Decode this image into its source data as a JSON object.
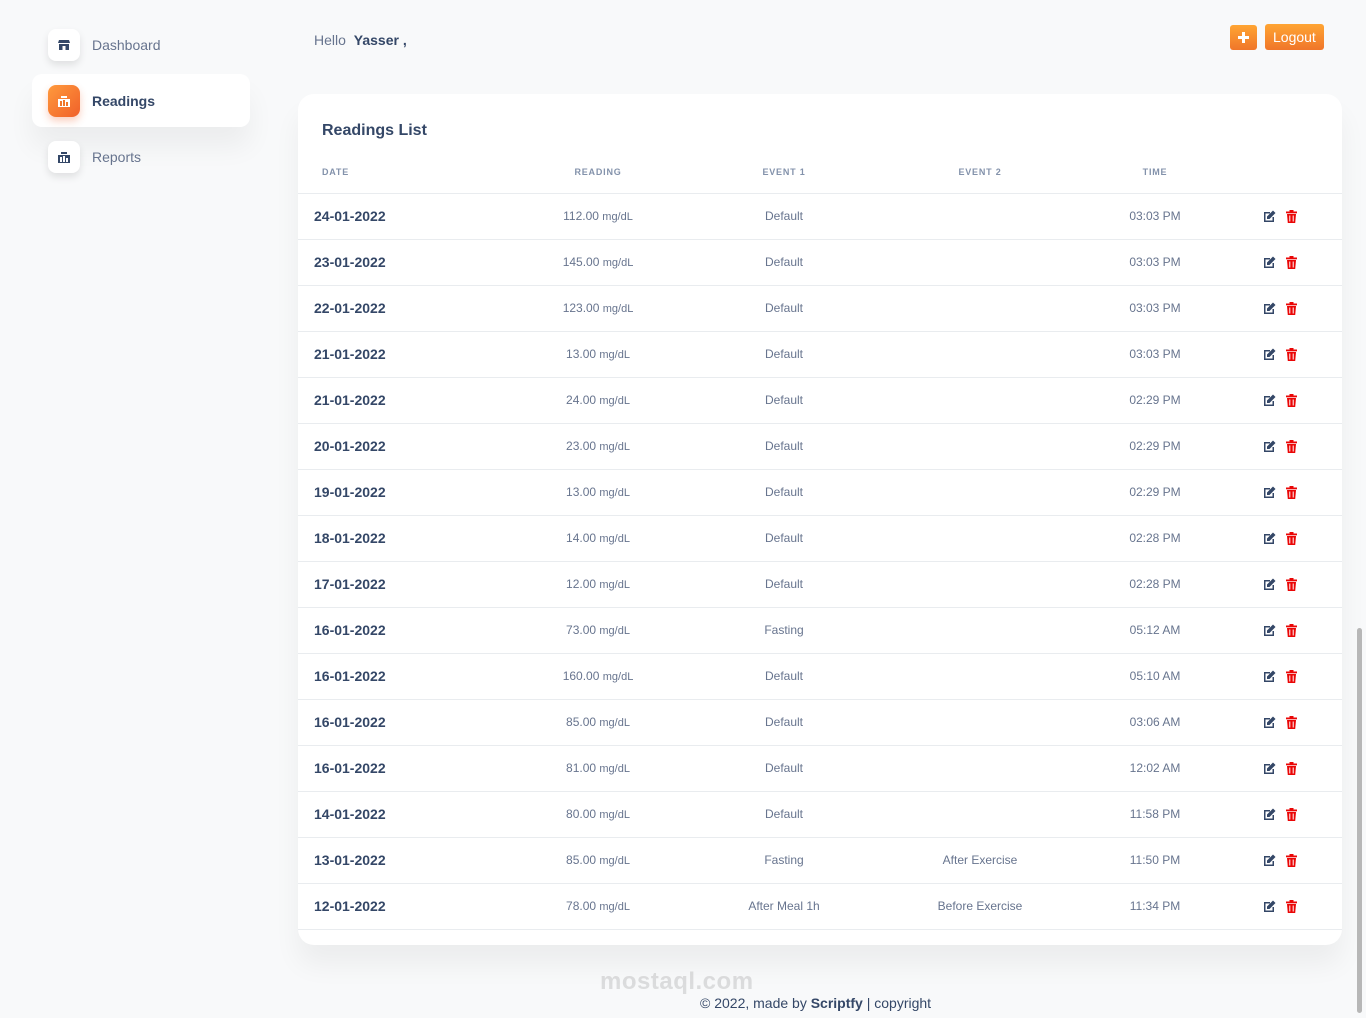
{
  "sidebar": {
    "items": [
      {
        "label": "Dashboard",
        "icon": "store-icon",
        "active": false
      },
      {
        "label": "Readings",
        "icon": "chart-icon",
        "active": true
      },
      {
        "label": "Reports",
        "icon": "report-icon",
        "active": false
      }
    ]
  },
  "header": {
    "greeting": "Hello",
    "username": "Yasser ,",
    "add_label": "+",
    "logout_label": "Logout"
  },
  "card": {
    "title": "Readings List",
    "columns": [
      "DATE",
      "READING",
      "EVENT 1",
      "EVENT 2",
      "TIME"
    ],
    "rows": [
      {
        "date": "24-01-2022",
        "reading": "112.00",
        "unit": "mg/dL",
        "event1": "Default",
        "event2": "",
        "time": "03:03 PM"
      },
      {
        "date": "23-01-2022",
        "reading": "145.00",
        "unit": "mg/dL",
        "event1": "Default",
        "event2": "",
        "time": "03:03 PM"
      },
      {
        "date": "22-01-2022",
        "reading": "123.00",
        "unit": "mg/dL",
        "event1": "Default",
        "event2": "",
        "time": "03:03 PM"
      },
      {
        "date": "21-01-2022",
        "reading": "13.00",
        "unit": "mg/dL",
        "event1": "Default",
        "event2": "",
        "time": "03:03 PM"
      },
      {
        "date": "21-01-2022",
        "reading": "24.00",
        "unit": "mg/dL",
        "event1": "Default",
        "event2": "",
        "time": "02:29 PM"
      },
      {
        "date": "20-01-2022",
        "reading": "23.00",
        "unit": "mg/dL",
        "event1": "Default",
        "event2": "",
        "time": "02:29 PM"
      },
      {
        "date": "19-01-2022",
        "reading": "13.00",
        "unit": "mg/dL",
        "event1": "Default",
        "event2": "",
        "time": "02:29 PM"
      },
      {
        "date": "18-01-2022",
        "reading": "14.00",
        "unit": "mg/dL",
        "event1": "Default",
        "event2": "",
        "time": "02:28 PM"
      },
      {
        "date": "17-01-2022",
        "reading": "12.00",
        "unit": "mg/dL",
        "event1": "Default",
        "event2": "",
        "time": "02:28 PM"
      },
      {
        "date": "16-01-2022",
        "reading": "73.00",
        "unit": "mg/dL",
        "event1": "Fasting",
        "event2": "",
        "time": "05:12 AM"
      },
      {
        "date": "16-01-2022",
        "reading": "160.00",
        "unit": "mg/dL",
        "event1": "Default",
        "event2": "",
        "time": "05:10 AM"
      },
      {
        "date": "16-01-2022",
        "reading": "85.00",
        "unit": "mg/dL",
        "event1": "Default",
        "event2": "",
        "time": "03:06 AM"
      },
      {
        "date": "16-01-2022",
        "reading": "81.00",
        "unit": "mg/dL",
        "event1": "Default",
        "event2": "",
        "time": "12:02 AM"
      },
      {
        "date": "14-01-2022",
        "reading": "80.00",
        "unit": "mg/dL",
        "event1": "Default",
        "event2": "",
        "time": "11:58 PM"
      },
      {
        "date": "13-01-2022",
        "reading": "85.00",
        "unit": "mg/dL",
        "event1": "Fasting",
        "event2": "After Exercise",
        "time": "11:50 PM"
      },
      {
        "date": "12-01-2022",
        "reading": "78.00",
        "unit": "mg/dL",
        "event1": "After Meal 1h",
        "event2": "Before Exercise",
        "time": "11:34 PM"
      }
    ]
  },
  "footer": {
    "prefix": "© 2022, made by",
    "brand": "Scriptfy",
    "suffix": "| copyright"
  },
  "watermark": "mostaql.com",
  "colors": {
    "accent": "#f0762a",
    "delete": "#ea0606",
    "edit": "#344767"
  }
}
